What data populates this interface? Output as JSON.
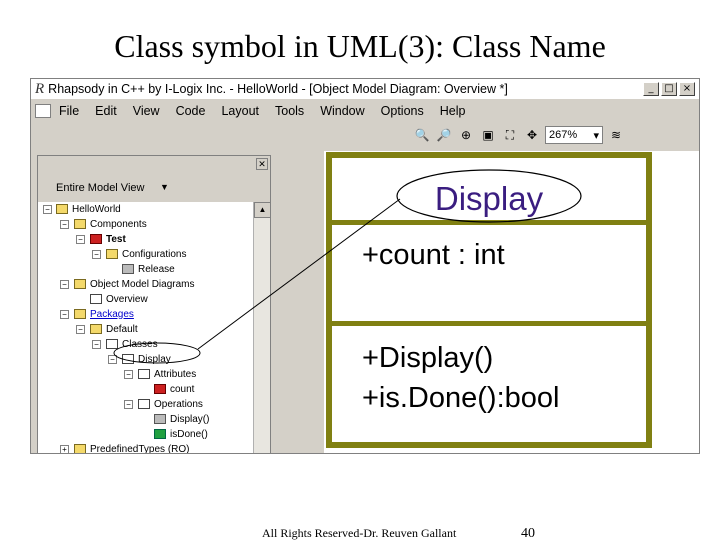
{
  "slide": {
    "title": "Class symbol in UML(3): Class Name",
    "footer_copyright": "All Rights Reserved-Dr. Reuven Gallant",
    "page_number": "40"
  },
  "window": {
    "title": "Rhapsody in C++ by I-Logix Inc. - HelloWorld - [Object Model Diagram: Overview *]",
    "app_icon": "R",
    "controls": [
      "_",
      "□",
      "×"
    ]
  },
  "menu": {
    "items": [
      "File",
      "Edit",
      "View",
      "Code",
      "Layout",
      "Tools",
      "Window",
      "Options",
      "Help"
    ],
    "icon": "document-icon"
  },
  "toolbar": {
    "zoom_value": "267%"
  },
  "browser": {
    "view_label": "Entire Model View",
    "tree": [
      {
        "label": "HelloWorld",
        "icon": "folder-icon"
      },
      {
        "label": "Components",
        "icon": "folder-icon"
      },
      {
        "label": "Test",
        "icon": "component-icon"
      },
      {
        "label": "Configurations",
        "icon": "folder-icon"
      },
      {
        "label": "Release",
        "icon": "configuration-icon"
      },
      {
        "label": "Object Model Diagrams",
        "icon": "folder-icon"
      },
      {
        "label": "Overview",
        "icon": "diagram-icon"
      },
      {
        "label": "Packages",
        "icon": "folder-icon"
      },
      {
        "label": "Default",
        "icon": "package-icon"
      },
      {
        "label": "Classes",
        "icon": "folder-icon"
      },
      {
        "label": "Display",
        "icon": "class-icon"
      },
      {
        "label": "Attributes",
        "icon": "folder-icon"
      },
      {
        "label": "count",
        "icon": "attribute-icon"
      },
      {
        "label": "Operations",
        "icon": "folder-icon"
      },
      {
        "label": "Display()",
        "icon": "constructor-icon"
      },
      {
        "label": "isDone()",
        "icon": "operation-icon"
      },
      {
        "label": "PredefinedTypes (RO)",
        "icon": "folder-icon"
      }
    ]
  },
  "class_symbol": {
    "name": "Display",
    "attribute": "+count : int",
    "operations": [
      "+Display()",
      "+is.Done():bool"
    ]
  },
  "colors": {
    "class_border": "#808012",
    "class_name_text": "#3a1d80"
  }
}
